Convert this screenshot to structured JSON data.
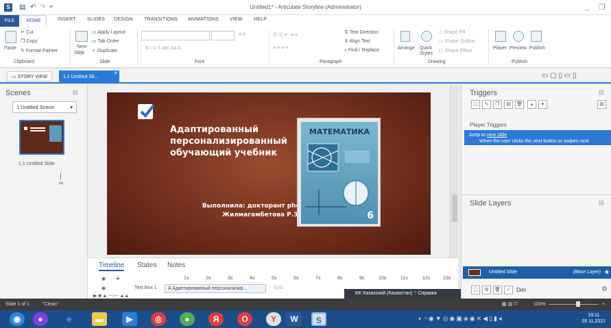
{
  "window": {
    "title": "Untitled1* - Articulate Storyline (Administrator)",
    "logo": "S",
    "minimize": "_",
    "restore": "❐"
  },
  "ribbon_tabs": [
    "FILE",
    "HOME",
    "INSERT",
    "SLIDES",
    "DESIGN",
    "TRANSITIONS",
    "ANIMATIONS",
    "VIEW",
    "HELP"
  ],
  "ribbon": {
    "clipboard": {
      "paste": "Paste",
      "cut": "Cut",
      "copy": "Copy",
      "format_painter": "Format Painter",
      "label": "Clipboard"
    },
    "slide": {
      "new": "New",
      "slide": "Slide",
      "apply_layout": "Apply Layout",
      "tab_order": "Tab Order",
      "duplicate": "Duplicate",
      "label": "Slide"
    },
    "font": {
      "label": "Font",
      "format_row": "B  I  U  S  abc  Aa  A",
      "grow_shrink": "A  A"
    },
    "paragraph": {
      "label": "Paragraph",
      "text_direction": "Text Direction",
      "align_text": "Align Text",
      "find_replace": "Find / Replace"
    },
    "drawing": {
      "label": "Drawing",
      "arrange": "Arrange",
      "quick_styles": "Quick Styles",
      "shape_fill": "Shape Fill",
      "shape_outline": "Shape Outline",
      "shape_effect": "Shape Effect"
    },
    "publish": {
      "label": "Publish",
      "player": "Player",
      "preview": "Preview",
      "publish": "Publish"
    }
  },
  "view_bar": {
    "story_view": "STORY VIEW",
    "slide_tab": "1.1 Untitled Sli...",
    "close_tab": "×"
  },
  "scenes": {
    "title": "Scenes",
    "selected_scene": "1 Untitled Scene",
    "thumb_label": "1.1 Untitled Slide"
  },
  "slide": {
    "title": "Адаптированный персонализированный обучающий учебник",
    "author": "Выполнила: докторант phd Жилмагамбетова Р.З.",
    "book_title": "МАТЕМАТИКА",
    "book_grade": "6"
  },
  "timeline": {
    "tabs": [
      "Timeline",
      "States",
      "Notes"
    ],
    "ticks": [
      "1s",
      "2s",
      "3s",
      "4s",
      "5s",
      "6s",
      "7s",
      "8s",
      "9s",
      "10s",
      "11s",
      "12s",
      "13s"
    ],
    "layer_name": "Text Box 1",
    "bar_text": "Адаптированный персонализир...",
    "end_label": "End"
  },
  "lang_popup": {
    "language": "KK Казахский (Казахстан)",
    "help": "Справка"
  },
  "triggers": {
    "title": "Triggers",
    "player_triggers": "Player Triggers",
    "jump_prefix": "Jump to ",
    "jump_link": "next slide",
    "jump_when": "When the user clicks the next button or swipes next"
  },
  "layers": {
    "title": "Slide Layers",
    "base_name": "Untitled Slide",
    "base_tag": "(Base Layer)",
    "dim_label": "Dim"
  },
  "status_bar": {
    "slide": "Slide 1 of 1",
    "theme": "\"Clean\"",
    "zoom": "100%"
  },
  "taskbar": {
    "time": "19:11",
    "date": "05.11.2021"
  },
  "colors": {
    "accent": "#2b7bd6",
    "file_tab": "#2b5797",
    "taskbar": "#1b4d8a"
  }
}
